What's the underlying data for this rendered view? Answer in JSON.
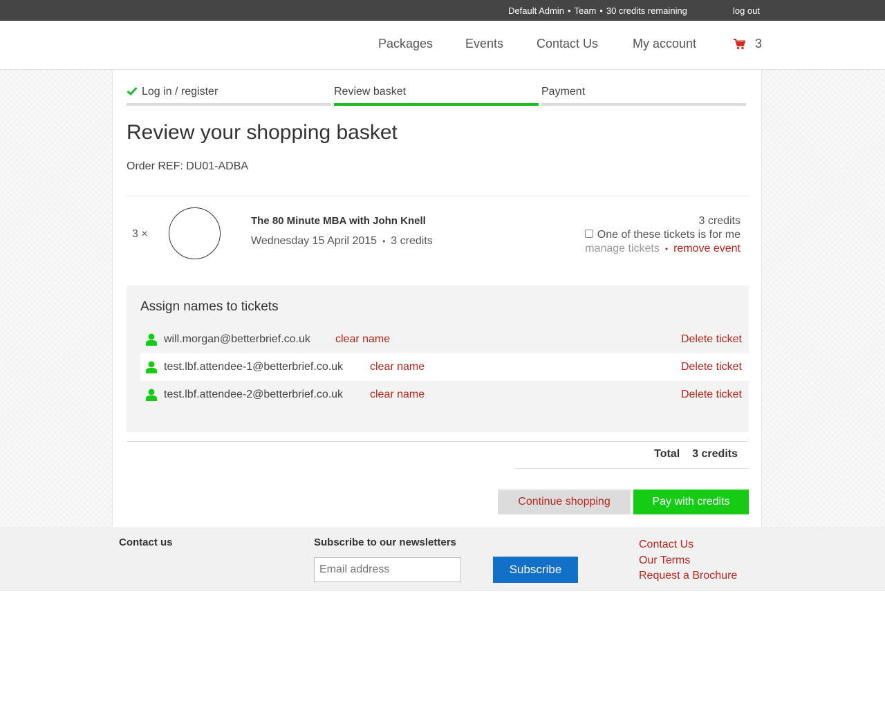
{
  "topbar": {
    "user": "Default Admin",
    "team": "Team",
    "credits": "30 credits remaining",
    "separator": "•",
    "logout": "log out"
  },
  "nav": {
    "items": [
      {
        "label": "Packages"
      },
      {
        "label": "Events"
      },
      {
        "label": "Contact Us"
      },
      {
        "label": "My account"
      }
    ],
    "cart_count": "3",
    "cart_color": "#d42a1d"
  },
  "steps": [
    {
      "label": "Log in / register",
      "completed": true
    },
    {
      "label": "Review basket",
      "active": true
    },
    {
      "label": "Payment"
    }
  ],
  "page": {
    "title": "Review your shopping basket",
    "order_ref": "Order REF: DU01-ADBA"
  },
  "event": {
    "quantity": "3 ×",
    "name": "The 80 Minute MBA with John Knell",
    "date": "Wednesday 15 April 2015",
    "meta_separator": "•",
    "credits": "3 credits",
    "price": "3 credits",
    "checkbox_label": "One of these tickets is for me",
    "checkbox_checked": false,
    "manage_label": "manage tickets",
    "remove_label": "remove event"
  },
  "assign": {
    "heading": "Assign names to tickets",
    "tickets": [
      {
        "email": "will.morgan@betterbrief.co.uk",
        "clear": "clear name",
        "delete": "Delete ticket"
      },
      {
        "email": "test.lbf.attendee-1@betterbrief.co.uk",
        "clear": "clear name",
        "delete": "Delete ticket"
      },
      {
        "email": "test.lbf.attendee-2@betterbrief.co.uk",
        "clear": "clear name",
        "delete": "Delete ticket"
      }
    ]
  },
  "total": {
    "label": "Total",
    "value": "3 credits"
  },
  "buttons": {
    "continue": "Continue shopping",
    "pay": "Pay with credits"
  },
  "footer": {
    "contact_heading": "Contact us",
    "newsletter_heading": "Subscribe to our newsletters",
    "email_placeholder": "Email address",
    "subscribe": "Subscribe",
    "links": [
      "Contact Us",
      "Our Terms",
      "Request a Brochure"
    ]
  },
  "colors": {
    "accent_green": "#14cc14",
    "link_red": "#b6261b",
    "subscribe_blue": "#1270c9",
    "topbar": "#454545"
  }
}
